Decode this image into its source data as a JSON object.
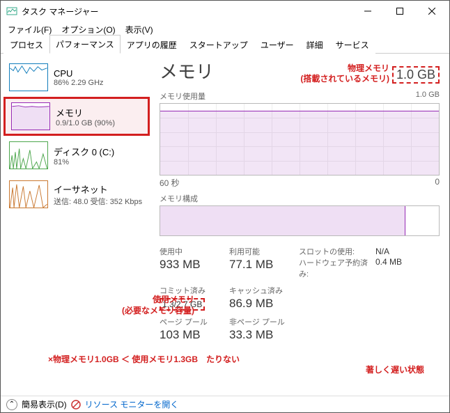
{
  "window": {
    "title": "タスク マネージャー"
  },
  "menu": {
    "file": "ファイル(F)",
    "options": "オプション(O)",
    "view": "表示(V)"
  },
  "tabs": {
    "processes": "プロセス",
    "performance": "パフォーマンス",
    "apphistory": "アプリの履歴",
    "startup": "スタートアップ",
    "users": "ユーザー",
    "details": "詳細",
    "services": "サービス"
  },
  "sidebar": {
    "cpu": {
      "name": "CPU",
      "sub": "86%  2.29 GHz"
    },
    "memory": {
      "name": "メモリ",
      "sub": "0.9/1.0 GB (90%)"
    },
    "disk": {
      "name": "ディスク 0 (C:)",
      "sub": "81%"
    },
    "ethernet": {
      "name": "イーサネット",
      "sub": "送信: 48.0 受信: 352 Kbps"
    }
  },
  "main": {
    "title": "メモリ",
    "total": "1.0 GB",
    "usage_label": "メモリ使用量",
    "usage_max": "1.0 GB",
    "axis_left": "60 秒",
    "axis_right": "0",
    "comp_label": "メモリ構成",
    "stats": {
      "inuse_label": "使用中",
      "inuse": "933 MB",
      "avail_label": "利用可能",
      "avail": "77.1 MB",
      "slot_label": "スロットの使用:",
      "slot": "N/A",
      "hw_label": "ハードウェア予約済み:",
      "hw": "0.4 MB",
      "commit_label": "コミット済み",
      "commit": "1.3/2.7 GB",
      "cache_label": "キャッシュ済み",
      "cache": "86.9 MB",
      "paged_label": "ページ プール",
      "paged": "103 MB",
      "nonpaged_label": "非ページ プール",
      "nonpaged": "33.3 MB"
    }
  },
  "annot": {
    "phys1": "物理メモリ",
    "phys2": "(搭載されているメモリ)",
    "used1": "使用メモリ",
    "used2": "(必要なメモリ容量)",
    "warn1": "×物理メモリ1.0GB ＜ 使用メモリ1.3GB　たりない",
    "warn2": "著しく遅い状態"
  },
  "footer": {
    "simple": "簡易表示(D)",
    "resmon": "リソース モニターを開く"
  },
  "chart_data": {
    "type": "area",
    "title": "メモリ使用量",
    "ylabel": "GB",
    "ylim": [
      0,
      1.0
    ],
    "xlabel": "秒",
    "xlim": [
      60,
      0
    ],
    "series": [
      {
        "name": "メモリ使用量",
        "approx_value": 0.9
      }
    ],
    "composition": {
      "used_fraction": 0.88
    }
  }
}
